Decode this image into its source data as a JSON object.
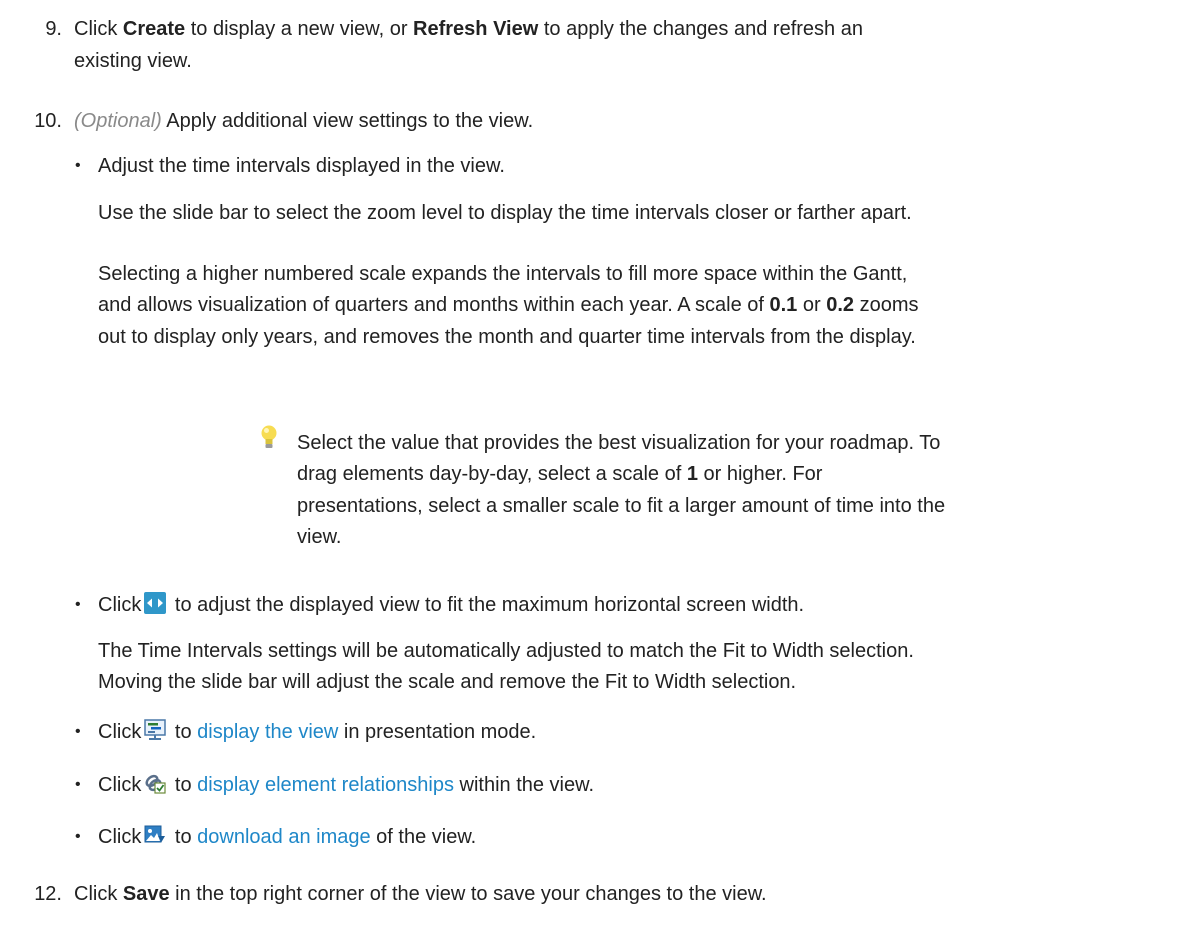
{
  "step9": {
    "number": "9.",
    "l1a": "Click ",
    "create": "Create",
    "l1b": " to display a new view, or ",
    "refresh": "Refresh View",
    "l1c": " to apply the changes and refresh an",
    "l2": "existing view."
  },
  "step10": {
    "number": "10.",
    "optional": "(Optional)",
    "text": " Apply additional view settings to the view.",
    "bullet1": "Adjust the time intervals displayed in the view.",
    "slide_text": "Use the slide bar to select the zoom level to display the time intervals closer or farther apart.",
    "scale_l1": "Selecting a higher numbered scale expands the intervals to fill more space within the Gantt,",
    "scale_l2a": "and allows visualization of quarters and months within each year. A scale of ",
    "scale_v1": "0.1",
    "scale_or": " or ",
    "scale_v2": "0.2",
    "scale_l2b": " zooms",
    "scale_l3": "out to display only years, and removes the month and quarter time intervals from the display.",
    "tip_l1": "Select the value that provides the best visualization for your roadmap. To",
    "tip_l2a": "drag elements day-by-day, select a scale of ",
    "tip_v": "1",
    "tip_l2b": " or higher. For",
    "tip_l3": "presentations, select a smaller scale to fit a larger amount of time into the",
    "tip_l4": "view.",
    "fit_click": "Click",
    "fit_text": " to adjust the displayed view to fit the maximum horizontal screen width.",
    "fit_p1": "The Time Intervals settings will be automatically adjusted to match the Fit to Width selection.",
    "fit_p2": "Moving the slide bar will adjust the scale and remove the Fit to Width selection.",
    "pres_click": "Click",
    "pres_to": " to ",
    "pres_link": "display the view",
    "pres_rest": " in presentation mode.",
    "rel_click": "Click",
    "rel_to": " to ",
    "rel_link": "display element relationships",
    "rel_rest": " within the view.",
    "img_click": "Click",
    "img_to": " to ",
    "img_link": "download an image",
    "img_rest": " of the view."
  },
  "step12": {
    "number": "12.",
    "a": "Click ",
    "save": "Save",
    "b": " in the top right corner of the view to save your changes to the view."
  },
  "icons": {
    "fit": "fit-to-width-icon",
    "presentation": "presentation-mode-icon",
    "relationships": "relationships-icon",
    "download": "download-image-icon",
    "tip": "lightbulb-icon"
  }
}
